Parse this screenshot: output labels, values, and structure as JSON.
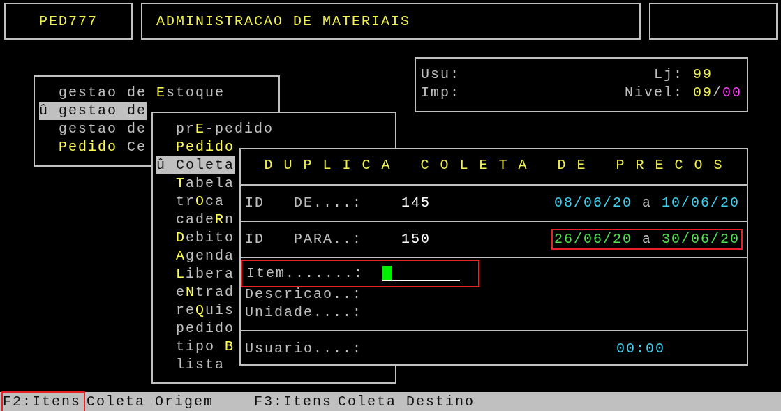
{
  "header": {
    "program": "PED777",
    "title": "ADMINISTRACAO DE MATERIAIS"
  },
  "info": {
    "user_label": "Usu:",
    "printer_label": "Imp:",
    "store_label": "Lj:",
    "store": "99",
    "level_label": "Nivel:",
    "level_code": "09",
    "level_separator": "/",
    "sublevel": "00"
  },
  "menu_main": {
    "marker": "û",
    "items": [
      {
        "label": "gestao de **E**stoque",
        "selected": false
      },
      {
        "label": "gestao de",
        "selected": true
      },
      {
        "label": "gestao de",
        "selected": false
      },
      {
        "label": "**Pedido** Ce",
        "selected": false
      }
    ]
  },
  "menu_sub": {
    "marker": "û",
    "items": [
      {
        "label": "pr**E**-pedido",
        "selected": false
      },
      {
        "label": "**Pedido**",
        "selected": false
      },
      {
        "label": "Coleta",
        "selected": true
      },
      {
        "label": "**T**abela",
        "selected": false
      },
      {
        "label": "tr**O**ca",
        "selected": false
      },
      {
        "label": "cade**R**n",
        "selected": false
      },
      {
        "label": "**D**ebito",
        "selected": false
      },
      {
        "label": "**A**genda",
        "selected": false
      },
      {
        "label": "**L**ibera",
        "selected": false
      },
      {
        "label": "e**N**trad",
        "selected": false
      },
      {
        "label": "re**Q**uis",
        "selected": false
      },
      {
        "label": "pedido",
        "selected": false
      },
      {
        "label": "tipo **B**",
        "selected": false
      },
      {
        "label": "lista",
        "selected": false
      }
    ]
  },
  "dialog": {
    "title": "D U P L I C A   C O L E T A   D E   P R E C O S",
    "ranges": [
      {
        "label": "ID   DE....:",
        "id": "145",
        "date_from": "08/06/20",
        "date_separator": "a",
        "date_to": "10/06/20",
        "color": "#40d0f0",
        "highlighted": false
      },
      {
        "label": "ID   PARA..:",
        "id": "150",
        "date_from": "26/06/20",
        "date_separator": "a",
        "date_to": "30/06/20",
        "color": "#50e050",
        "highlighted": true
      }
    ],
    "fields": [
      {
        "label": "Item.......:",
        "kind": "input",
        "focused": true,
        "highlighted": true
      },
      {
        "label": "Descricao..:",
        "kind": "text",
        "focused": false,
        "highlighted": false
      },
      {
        "label": "Unidade....:",
        "kind": "text",
        "focused": false,
        "highlighted": false
      }
    ],
    "user": {
      "label": "Usuario....:",
      "value": "00:00"
    }
  },
  "status_bar": [
    {
      "hotkey": "F2:Itens",
      "text": "Coleta Origem",
      "highlighted": true
    },
    {
      "hotkey": "F3:Itens",
      "text": "Coleta Destino",
      "highlighted": false
    }
  ]
}
